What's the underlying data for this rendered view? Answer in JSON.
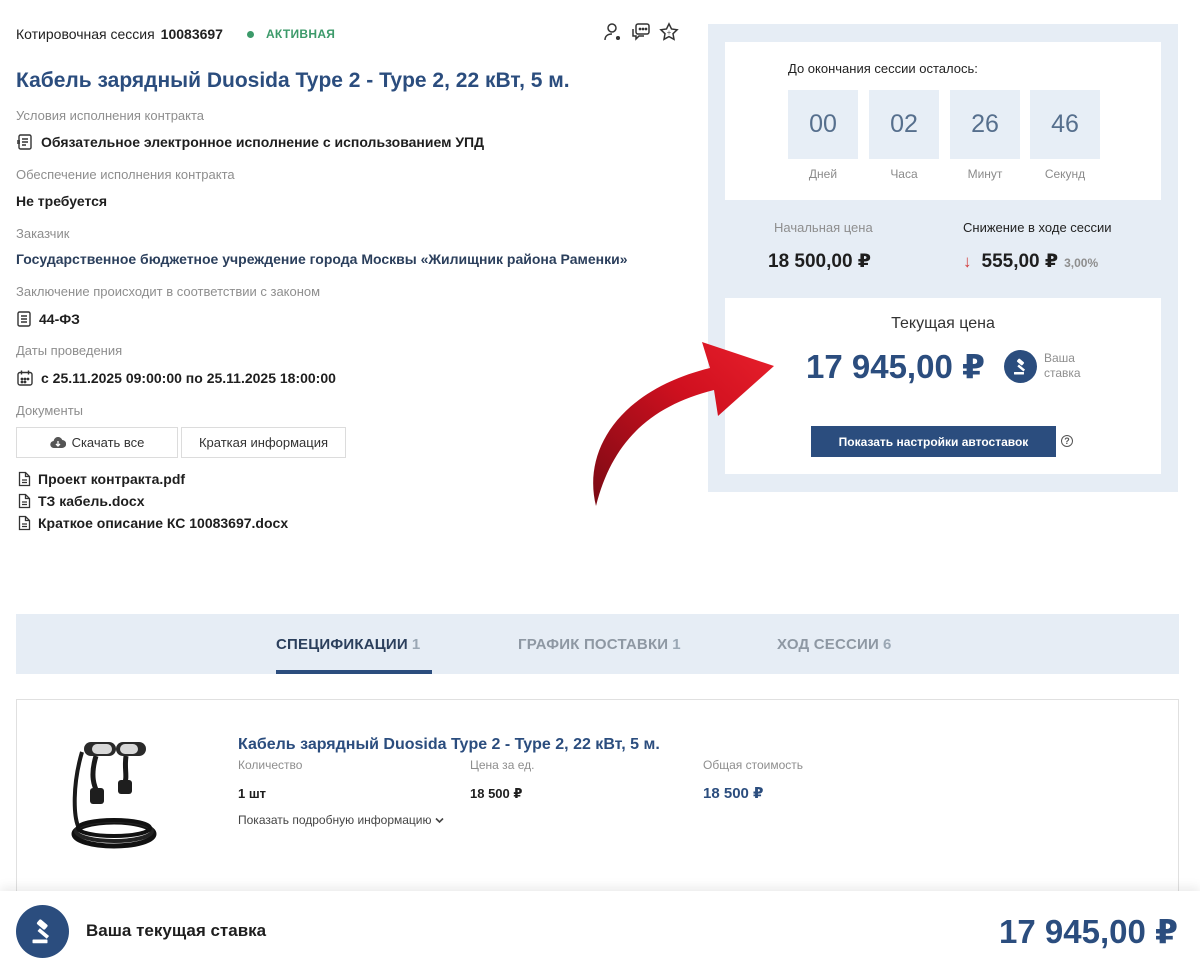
{
  "session": {
    "label": "Котировочная сессия",
    "number": "10083697",
    "status": "АКТИВНАЯ"
  },
  "header_icons": [
    "user-icon",
    "chat-icon",
    "star-icon"
  ],
  "title": "Кабель зарядный Duosida Type 2 - Type 2, 22 кВт, 5 м.",
  "details": {
    "conditions_label": "Условия исполнения контракта",
    "conditions_value": "Обязательное электронное исполнение с использованием УПД",
    "security_label": "Обеспечение исполнения контракта",
    "security_value": "Не требуется",
    "customer_label": "Заказчик",
    "customer_value": "Государственное бюджетное учреждение города Москвы «Жилищник района Раменки»",
    "law_label": "Заключение происходит в соответствии с законом",
    "law_value": "44-ФЗ",
    "dates_label": "Даты проведения",
    "dates_value": "с 25.11.2025 09:00:00 по 25.11.2025 18:00:00",
    "docs_label": "Документы"
  },
  "doc_buttons": {
    "download_all": "Скачать все",
    "brief_info": "Краткая информация"
  },
  "files": [
    "Проект контракта.pdf",
    "ТЗ кабель.docx",
    "Краткое описание КС 10083697.docx"
  ],
  "timer": {
    "title": "До окончания сессии осталось:",
    "days": "00",
    "days_label": "Дней",
    "hours": "02",
    "hours_label": "Часа",
    "minutes": "26",
    "minutes_label": "Минут",
    "seconds": "46",
    "seconds_label": "Секунд"
  },
  "prices": {
    "start_label": "Начальная цена",
    "start_value": "18 500,00 ₽",
    "reduction_label": "Снижение в ходе сессии",
    "reduction_value": "555,00 ₽",
    "reduction_pct": "3,00%",
    "current_label": "Текущая цена",
    "current_value": "17 945,00 ₽",
    "your_bid": "Ваша ставка",
    "autobid_button": "Показать настройки автоставок",
    "help": "?"
  },
  "tabs": [
    {
      "label": "СПЕЦИФИКАЦИИ",
      "count": "1",
      "active": true
    },
    {
      "label": "ГРАФИК ПОСТАВКИ",
      "count": "1",
      "active": false
    },
    {
      "label": "ХОД СЕССИИ",
      "count": "6",
      "active": false
    }
  ],
  "spec": {
    "title": "Кабель зарядный Duosida Type 2 - Type 2, 22 кВт, 5 м.",
    "qty_label": "Количество",
    "qty_value": "1 шт",
    "unit_price_label": "Цена за ед.",
    "unit_price_value": "18 500 ₽",
    "total_label": "Общая стоимость",
    "total_value": "18 500 ₽",
    "more_info": "Показать подробную информацию"
  },
  "bottom": {
    "label": "Ваша текущая ставка",
    "price": "17 945,00 ₽"
  },
  "colors": {
    "brand": "#2b4d7e",
    "active_status": "#3c9a6a",
    "panel_bg": "#e6edf5",
    "decrease": "#d23b3b",
    "annotation_arrow": "#c8102e"
  }
}
